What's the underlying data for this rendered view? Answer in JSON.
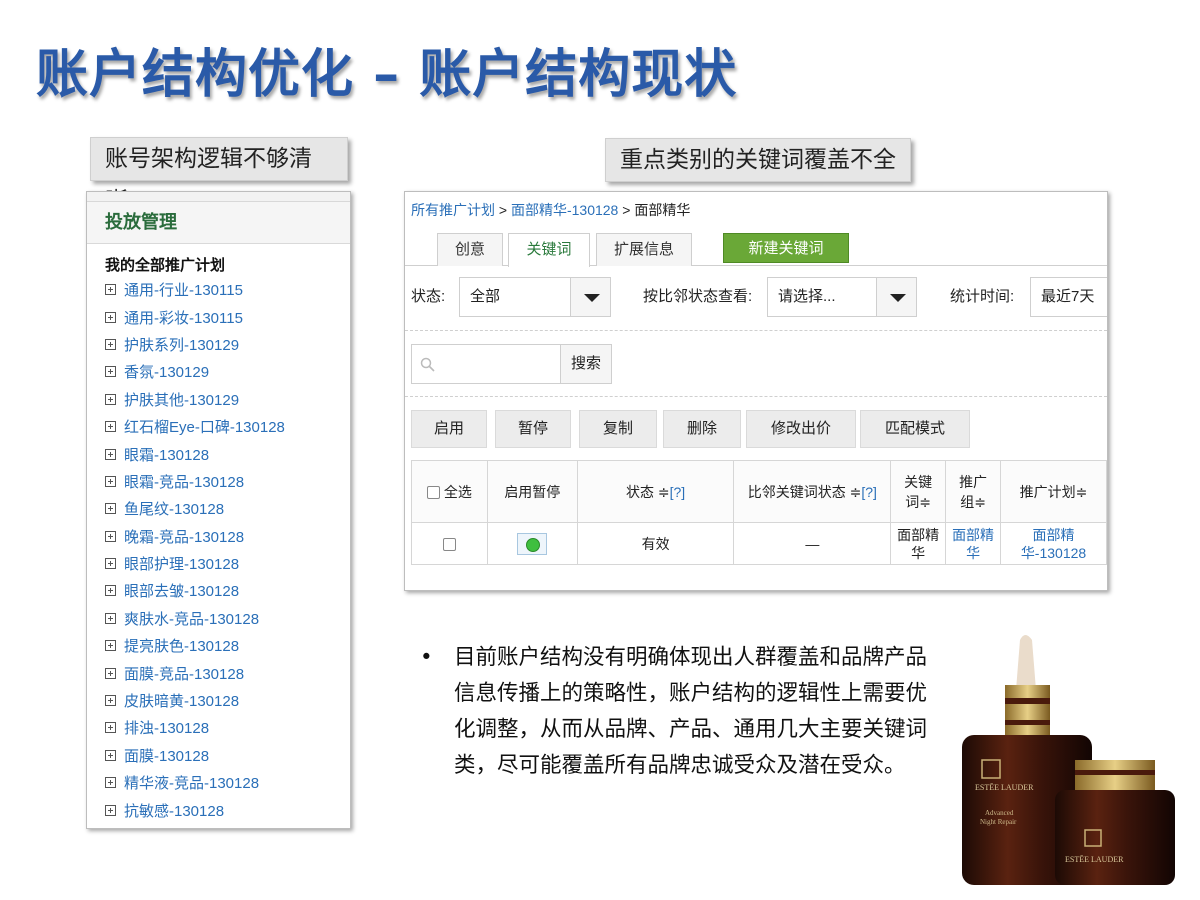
{
  "title": "账户结构优化 – 账户结构现状",
  "left_label": "账号架构逻辑不够清晰",
  "right_label": "重点类别的关键词覆盖不全",
  "left_panel": {
    "header": "投放管理",
    "all_plans": "我的全部推广计划",
    "items": [
      "通用-行业-130115",
      "通用-彩妆-130115",
      "护肤系列-130129",
      "香氛-130129",
      "护肤其他-130129",
      "红石榴Eye-口碑-130128",
      "眼霜-130128",
      "眼霜-竞品-130128",
      "鱼尾纹-130128",
      "晚霜-竞品-130128",
      "眼部护理-130128",
      "眼部去皱-130128",
      "爽肤水-竞品-130128",
      "提亮肤色-130128",
      "面膜-竞品-130128",
      "皮肤暗黄-130128",
      "排浊-130128",
      "面膜-130128",
      "精华液-竞品-130128",
      "抗敏感-130128"
    ]
  },
  "right_panel": {
    "breadcrumb": {
      "root": "所有推广计划",
      "sep": " > ",
      "plan": "面部精华-130128",
      "group": "面部精华"
    },
    "tabs": [
      "创意",
      "关键词",
      "扩展信息"
    ],
    "new_keyword_button": "新建关键词",
    "filters": {
      "status_label": "状态:",
      "status_value": "全部",
      "neighbor_label": "按比邻状态查看:",
      "neighbor_value": "请选择...",
      "time_label": "统计时间:",
      "time_value": "最近7天"
    },
    "search_button": "搜索",
    "actions": [
      "启用",
      "暂停",
      "复制",
      "删除",
      "修改出价",
      "匹配模式"
    ],
    "table": {
      "headers": {
        "select_all": "全选",
        "enable_pause": "启用暂停",
        "status": "状态",
        "neighbor_status": "比邻关键词状态",
        "help": "[?]",
        "keyword_line1": "关键",
        "keyword_line2": "词",
        "group_line1": "推广",
        "group_line2": "组",
        "plan": "推广计划",
        "sort": "≑"
      },
      "row": {
        "status": "有效",
        "neighbor_status": "—",
        "keyword_line1": "面部精",
        "keyword_line2": "华",
        "group_line1": "面部精",
        "group_line2": "华",
        "plan_line1": "面部精",
        "plan_line2": "华-130128"
      }
    }
  },
  "bullet": {
    "marker": "•",
    "text": "目前账户结构没有明确体现出人群覆盖和品牌产品信息传播上的策略性，账户结构的逻辑性上需要优化调整，从而从品牌、产品、通用几大主要关键词类，尽可能覆盖所有品牌忠诚受众及潜在受众。"
  },
  "product_image": {
    "brand": "ESTĒE LAUDER",
    "big_bottle_lines": [
      "Advanced",
      "Night Repair"
    ],
    "small_bottle_brand": "ESTĒE LAUDER"
  }
}
